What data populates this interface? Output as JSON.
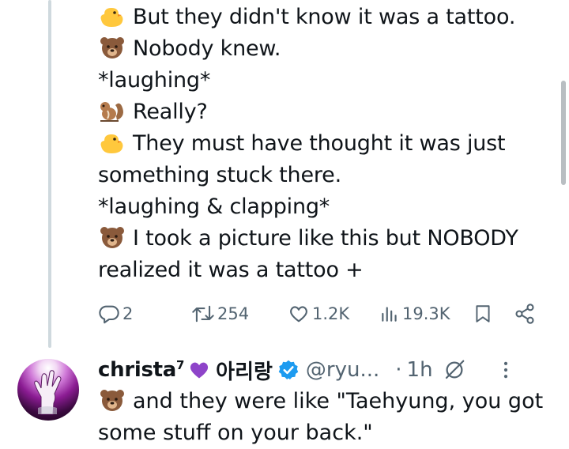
{
  "tweet": {
    "lines": [
      {
        "emoji": "chick-emoji",
        "text": "But they didn't know it was a tattoo."
      },
      {
        "emoji": "bear-emoji",
        "text": "Nobody knew."
      },
      {
        "emoji": "",
        "text": "*laughing*"
      },
      {
        "emoji": "chipmunk-emoji",
        "text": "Really?"
      },
      {
        "emoji": "chick-emoji",
        "text": "They must have thought it was just"
      },
      {
        "emoji": "",
        "text": "something stuck there."
      },
      {
        "emoji": "",
        "text": "*laughing & clapping*"
      },
      {
        "emoji": "bear-emoji",
        "text": "I took a picture like this but NOBODY"
      },
      {
        "emoji": "",
        "text": "realized it was a tattoo +"
      }
    ],
    "actions": {
      "replies": "2",
      "reposts": "254",
      "likes": "1.2K",
      "views": "19.3K"
    }
  },
  "reply": {
    "display_name": "christa",
    "superscript": "7",
    "name_suffix": "아리랑",
    "handle": "@ryu...",
    "dot": "·",
    "time": "1h",
    "text_line1": "and they were like \"Taehyung, you got",
    "text_line2": "some stuff on your back.\""
  },
  "colors": {
    "text": "#0f1419",
    "muted": "#536471",
    "thread_line": "#cfd9de",
    "verified": "#1d9bf0",
    "purple_heart": "#8e44c9"
  }
}
